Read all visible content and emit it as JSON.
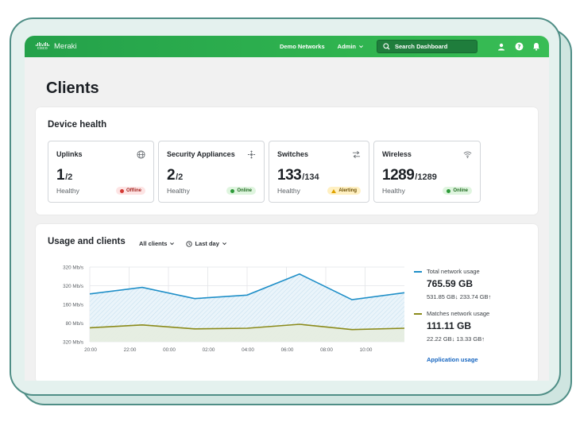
{
  "header": {
    "brand_small": "cisco",
    "product": "Meraki",
    "nav_networks": "Demo Networks",
    "nav_admin": "Admin",
    "search_placeholder": "Search Dashboard"
  },
  "page": {
    "title": "Clients"
  },
  "device_health": {
    "title": "Device health",
    "tiles": [
      {
        "name": "Uplinks",
        "count": "1",
        "total": "/2",
        "status_label": "Healthy",
        "badge": "Offline",
        "badge_type": "red",
        "icon": "globe-icon"
      },
      {
        "name": "Security Appliances",
        "count": "2",
        "total": "/2",
        "status_label": "Healthy",
        "badge": "Online",
        "badge_type": "green",
        "icon": "appliance-icon"
      },
      {
        "name": "Switches",
        "count": "133",
        "total": "/134",
        "status_label": "Healthy",
        "badge": "Alerting",
        "badge_type": "yellow",
        "icon": "switch-icon"
      },
      {
        "name": "Wireless",
        "count": "1289",
        "total": "/1289",
        "status_label": "Healthy",
        "badge": "Online",
        "badge_type": "green",
        "icon": "wifi-icon"
      }
    ]
  },
  "usage": {
    "title": "Usage and clients",
    "filter_clients": "All clients",
    "filter_time": "Last day",
    "legend": [
      {
        "label": "Total network usage",
        "value": "765.59 GB",
        "sub": "531.85 GB↓ 233.74 GB↑",
        "color": "#1f8fc8"
      },
      {
        "label": "Matches network usage",
        "value": "111.11 GB",
        "sub": "22.22 GB↓ 13.33 GB↑",
        "color": "#8a8a1a"
      }
    ],
    "link": "Application usage"
  },
  "chart_data": {
    "type": "area",
    "y_tick_labels": [
      "320 Mb/s",
      "320 Mb/s",
      "160 Mb/s",
      "80 Mb/s",
      "320 Mb/s"
    ],
    "x": [
      "20:00",
      "22:00",
      "00:00",
      "02:00",
      "04:00",
      "06:00",
      "08:00",
      "10:00"
    ],
    "series": [
      {
        "name": "Total network usage",
        "values": [
          205,
          233,
          185,
          200,
          290,
          180,
          210
        ],
        "color": "#1f8fc8"
      },
      {
        "name": "Matches network usage",
        "values": [
          60,
          72,
          55,
          58,
          75,
          52,
          58
        ],
        "color": "#8a8a1a"
      }
    ]
  }
}
